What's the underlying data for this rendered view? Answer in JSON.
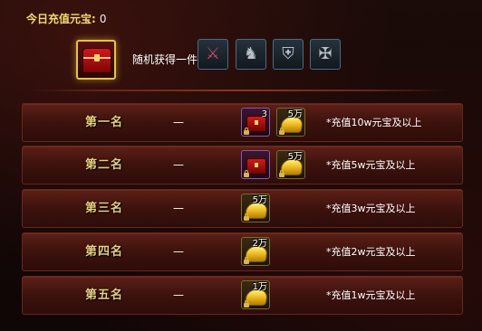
{
  "header": {
    "title": "今日充值元宝:",
    "count": "0"
  },
  "reward_preview": {
    "main_item_icon": "red-treasure-chest-icon",
    "random_label": "随机获得一件",
    "random_items": [
      {
        "icon": "scythe-weapon-icon",
        "glyph": "⚔"
      },
      {
        "icon": "mount-icon",
        "glyph": "♞"
      },
      {
        "icon": "armor-icon",
        "glyph": "⛨"
      },
      {
        "icon": "claw-weapon-icon",
        "glyph": "✠"
      }
    ]
  },
  "ranks": [
    {
      "name": "第一名",
      "dash": "—",
      "rewards": [
        {
          "type": "chest",
          "qty": "3"
        },
        {
          "type": "ingot",
          "qty": "5万"
        }
      ],
      "condition": "*充值10w元宝及以上"
    },
    {
      "name": "第二名",
      "dash": "—",
      "rewards": [
        {
          "type": "chest",
          "qty": ""
        },
        {
          "type": "ingot",
          "qty": "5万"
        }
      ],
      "condition": "*充值5w元宝及以上"
    },
    {
      "name": "第三名",
      "dash": "—",
      "rewards": [
        {
          "type": "ingot",
          "qty": "5万"
        }
      ],
      "condition": "*充值3w元宝及以上"
    },
    {
      "name": "第四名",
      "dash": "—",
      "rewards": [
        {
          "type": "ingot",
          "qty": "2万"
        }
      ],
      "condition": "*充值2w元宝及以上"
    },
    {
      "name": "第五名",
      "dash": "—",
      "rewards": [
        {
          "type": "ingot",
          "qty": "1万"
        }
      ],
      "condition": "*充值1w元宝及以上"
    }
  ],
  "colors": {
    "title": "#f3d96b",
    "rank_name": "#e8ce80",
    "row_border": "#6b261a",
    "highlight": "#e0c542"
  }
}
